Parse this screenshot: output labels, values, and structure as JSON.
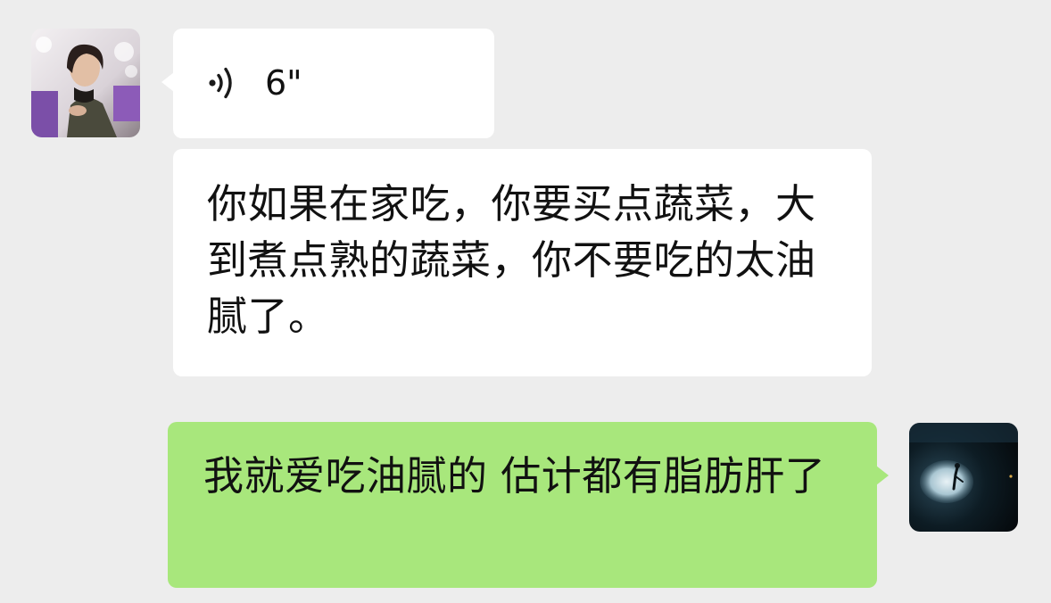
{
  "chat": {
    "messages": [
      {
        "sender": "contact",
        "kind": "voice",
        "avatar_icon": "avatar-woman-photo",
        "voice_icon": "voice-wave-icon",
        "duration": "6\""
      },
      {
        "sender": "contact",
        "kind": "text",
        "text": "你如果在家吃，你要买点蔬菜，大到煮点熟的蔬菜，你不要吃的太油腻了。"
      },
      {
        "sender": "me",
        "kind": "text",
        "avatar_icon": "avatar-underwater-photo",
        "text": "我就爱吃油腻的 估计都有脂肪肝了"
      }
    ]
  },
  "colors": {
    "background": "#ededed",
    "incoming_bubble": "#ffffff",
    "outgoing_bubble": "#a8e77c",
    "text": "#111111"
  }
}
